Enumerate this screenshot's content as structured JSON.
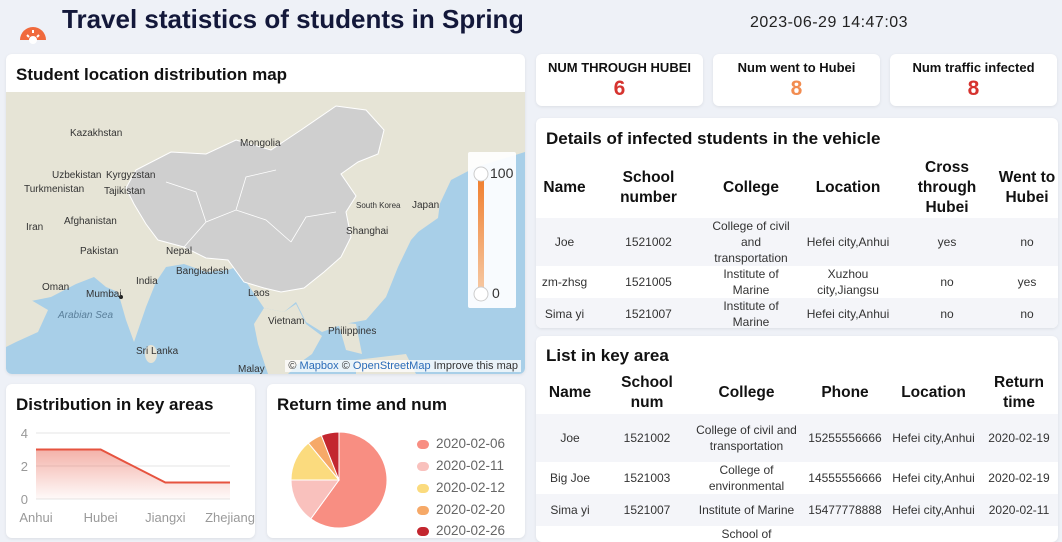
{
  "header": {
    "title": "Travel statistics of students in Spring Festival",
    "datetime": "2023-06-29 14:47:03"
  },
  "colors": {
    "accent_red": "#d6332f",
    "accent_orange": "#f28c50",
    "title_navy": "#13183a",
    "line_series": "#e6533f",
    "gradient_high": "#f07c2a",
    "gradient_low": "#f6c9a4"
  },
  "map_card": {
    "title": "Student location distribution map",
    "labels": [
      "Kazakhstan",
      "Mongolia",
      "Uzbekistan",
      "Kyrgyzstan",
      "Turkmenistan",
      "Tajikistan",
      "Afghanistan",
      "Iran",
      "Pakistan",
      "Nepal",
      "India",
      "Bangladesh",
      "Oman",
      "Mumbai",
      "Arabian Sea",
      "Sri Lanka",
      "Laos",
      "Vietnam",
      "Philippines",
      "South Korea",
      "Japan",
      "Shanghai",
      "Malay"
    ],
    "legend_max": "100",
    "legend_min": "0",
    "attribution_prefix": "©",
    "attribution_mapbox": "Mapbox",
    "attribution_sep": "©",
    "attribution_osm": "OpenStreetMap",
    "attribution_improve": "Improve this map"
  },
  "stats": [
    {
      "label": "NUM THROUGH HUBEI",
      "value": "6",
      "color": "#d6332f"
    },
    {
      "label": "Num went to Hubei",
      "value": "8",
      "color": "#f28c50"
    },
    {
      "label": "Num traffic infected",
      "value": "8",
      "color": "#d6332f"
    }
  ],
  "infected": {
    "title": "Details of infected students in the vehicle",
    "columns": [
      "Name",
      "School number",
      "College",
      "Location",
      "Cross through Hubei",
      "Went to Hubei"
    ],
    "rows": [
      [
        "Joe",
        "1521002",
        "College of civil and transportation",
        "Hefei city,Anhui",
        "yes",
        "no"
      ],
      [
        "zm-zhsg",
        "1521005",
        "Institute of Marine",
        "Xuzhou city,Jiangsu",
        "no",
        "yes"
      ],
      [
        "Sima yi",
        "1521007",
        "Institute of Marine",
        "Hefei city,Anhui",
        "no",
        "no"
      ]
    ]
  },
  "key_area": {
    "title": "List in key area",
    "columns": [
      "Name",
      "School num",
      "College",
      "Phone",
      "Location",
      "Return time"
    ],
    "rows": [
      [
        "Joe",
        "1521002",
        "College of civil and transportation",
        "15255556666",
        "Hefei city,Anhui",
        "2020-02-19"
      ],
      [
        "Big Joe",
        "1521003",
        "College of environmental",
        "14555556666",
        "Hefei city,Anhui",
        "2020-02-19"
      ],
      [
        "Sima yi",
        "1521007",
        "Institute of Marine",
        "15477778888",
        "Hefei city,Anhui",
        "2020-02-11"
      ],
      [
        "",
        "",
        "School of",
        "",
        "",
        ""
      ]
    ]
  },
  "chart_data": [
    {
      "type": "area",
      "title": "Distribution in key areas",
      "categories": [
        "Anhui",
        "Hubei",
        "Jiangxi",
        "Zhejiang"
      ],
      "values": [
        3,
        3,
        1,
        1
      ],
      "yticks": [
        "0",
        "2",
        "4"
      ],
      "ylim": [
        0,
        4
      ],
      "grid": true,
      "color": "#e6533f"
    },
    {
      "type": "pie",
      "title": "Return time and num",
      "legend_position": "right",
      "series": [
        {
          "name": "2020-02-06",
          "value": 60,
          "color": "#f88e82"
        },
        {
          "name": "2020-02-11",
          "value": 15,
          "color": "#f9c1bd"
        },
        {
          "name": "2020-02-12",
          "value": 14,
          "color": "#fbdb7e"
        },
        {
          "name": "2020-02-20",
          "value": 5,
          "color": "#f6a968"
        },
        {
          "name": "",
          "value": 6,
          "color": "#c3262f"
        }
      ],
      "legend_clipped_label": "2020-02-26"
    }
  ]
}
